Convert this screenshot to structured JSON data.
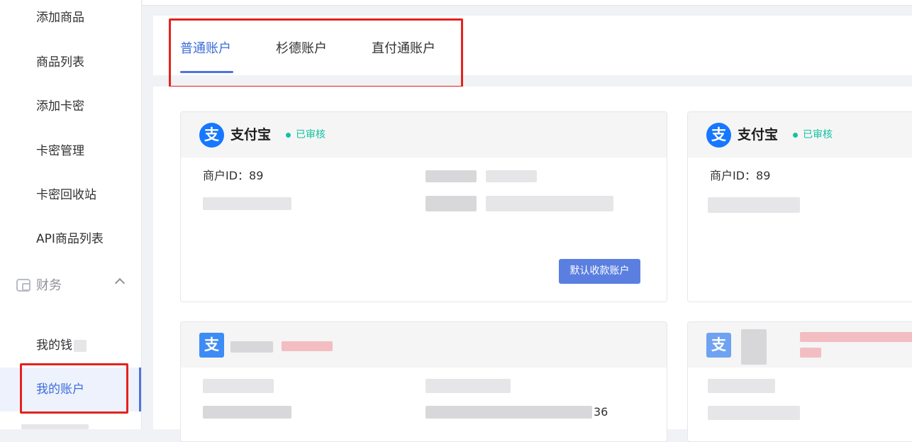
{
  "sidebar": {
    "items": [
      {
        "label": "添加商品"
      },
      {
        "label": "商品列表"
      },
      {
        "label": "添加卡密"
      },
      {
        "label": "卡密管理"
      },
      {
        "label": "卡密回收站"
      },
      {
        "label": "API商品列表"
      }
    ],
    "group": {
      "label": "财务"
    },
    "sub_items": [
      {
        "label": "我的钱"
      },
      {
        "label": "我的账户"
      }
    ]
  },
  "tabs": [
    {
      "label": "普通账户"
    },
    {
      "label": "杉德账户"
    },
    {
      "label": "直付通账户"
    }
  ],
  "cards": [
    {
      "icon_glyph": "支",
      "title": "支付宝",
      "status": "已审核",
      "merchant_id": "商户ID：89",
      "default_button": "默认收款账户"
    },
    {
      "icon_glyph": "支",
      "title": "支付宝",
      "status": "已审核",
      "merchant_id": "商户ID：89"
    },
    {
      "icon_glyph": "支"
    },
    {
      "icon_glyph": "支",
      "partial_number": "36"
    }
  ],
  "colors": {
    "accent": "#4f74de",
    "status_green": "#13c2a3",
    "annotation_red": "#e5221d",
    "alipay_blue": "#1677ff"
  }
}
